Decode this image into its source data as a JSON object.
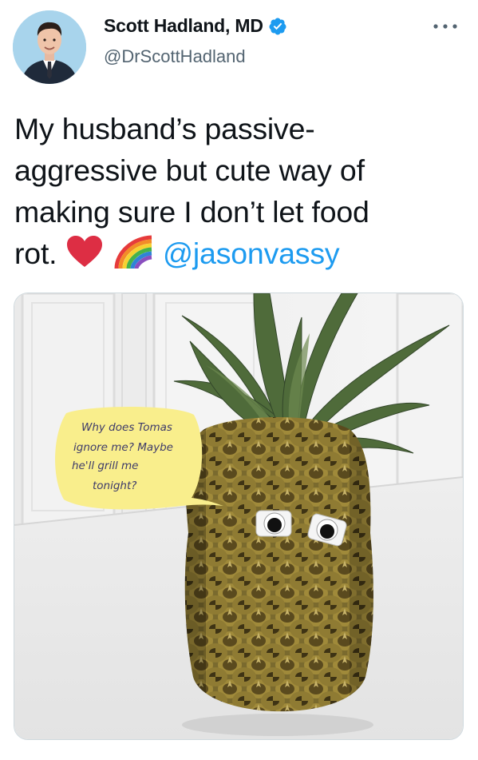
{
  "author": {
    "display_name": "Scott Hadland, MD",
    "handle": "@DrScottHadland",
    "verified": true,
    "accent_color": "#1d9bf0"
  },
  "tweet": {
    "text_line1": "My husband’s passive-",
    "text_line2": "aggressive but cute way of",
    "text_line3": "making sure I don’t let food",
    "text_line4_prefix": "rot.",
    "emojis": [
      "heart-emoji",
      "rainbow-emoji"
    ],
    "mention": "@jasonvassy"
  },
  "media": {
    "sticky_note": {
      "line1": "Why does Tomas",
      "line2": "ignore me? Maybe",
      "line3": "he'll grill me",
      "line4": "tonight?"
    }
  },
  "icons": {
    "verified": "verified-badge-icon",
    "more": "more-options-icon"
  }
}
